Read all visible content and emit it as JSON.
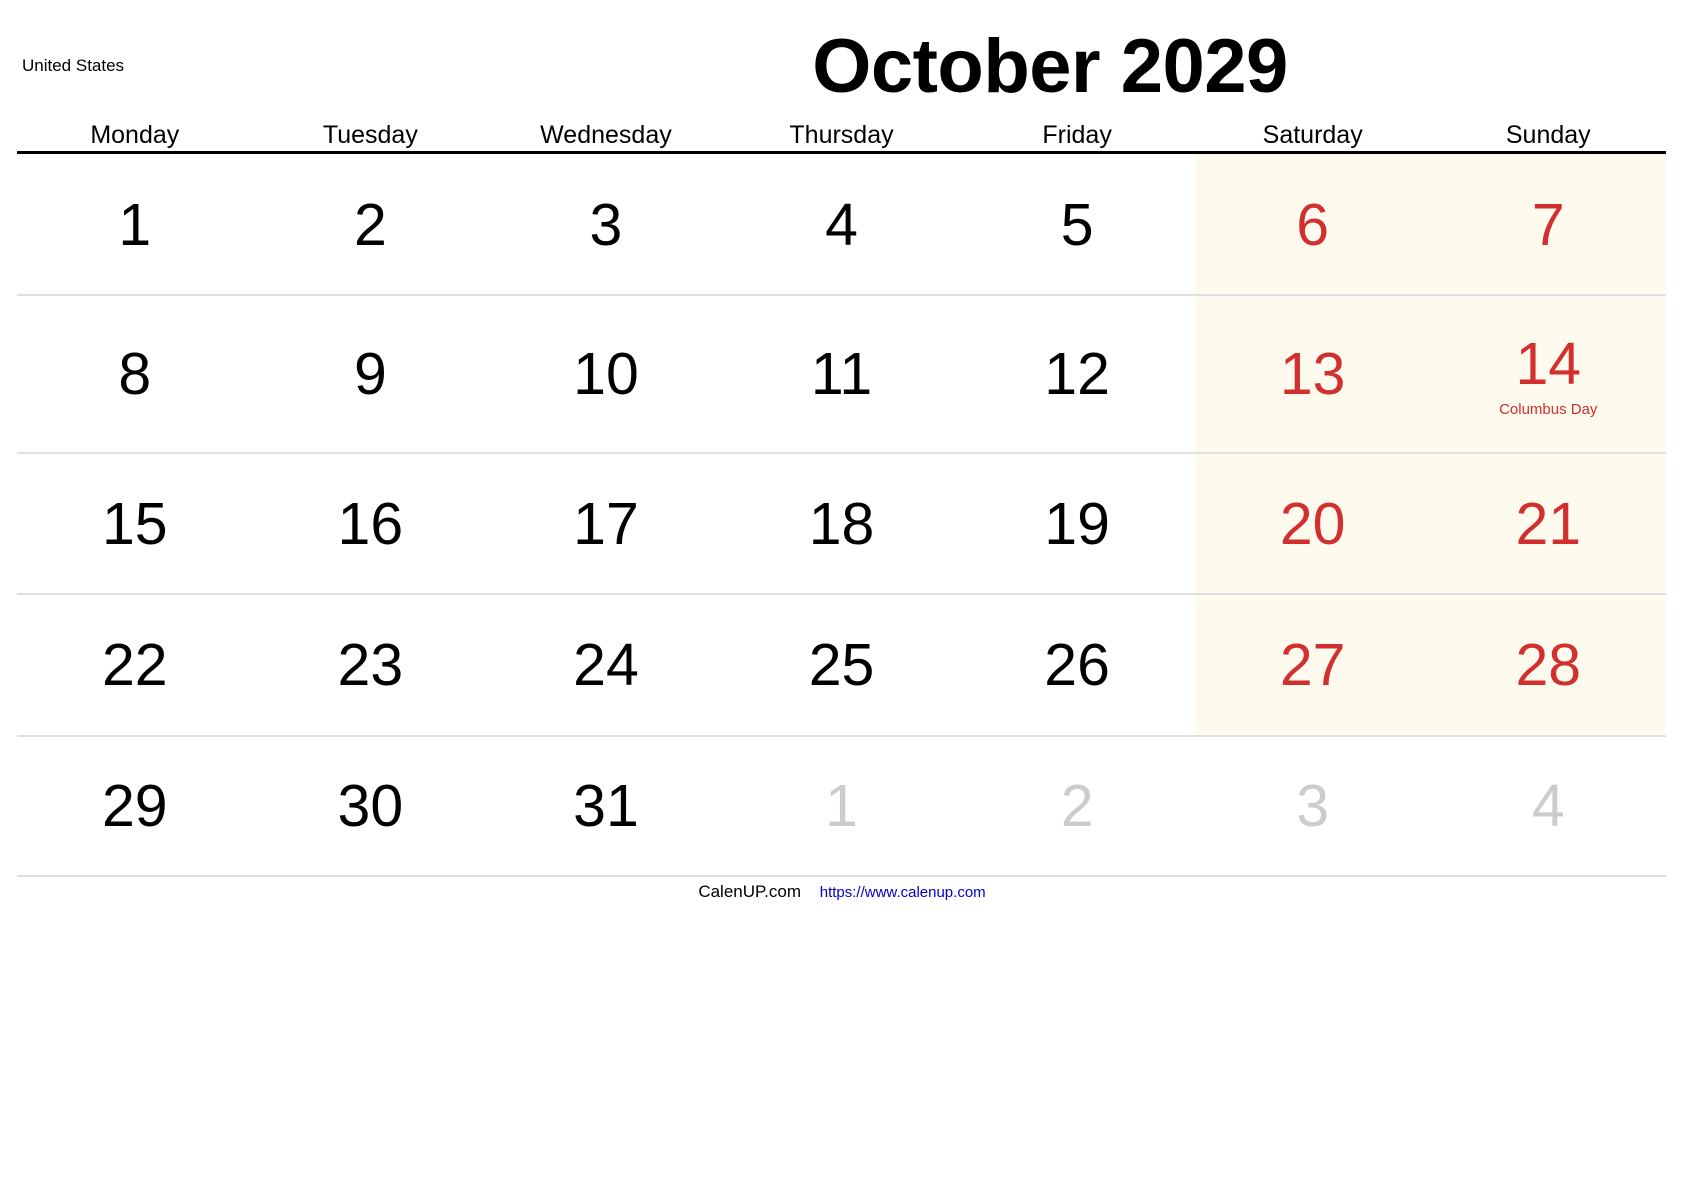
{
  "country": "United States",
  "title": "October 2029",
  "weekdays": [
    "Monday",
    "Tuesday",
    "Wednesday",
    "Thursday",
    "Friday",
    "Saturday",
    "Sunday"
  ],
  "colors": {
    "weekend_text": "#d22f2f",
    "weekend_background": "#fffaee",
    "other_month_text": "#cccccc",
    "link": "#0000cc"
  },
  "weeks": [
    [
      {
        "day": "1",
        "type": "weekday"
      },
      {
        "day": "2",
        "type": "weekday"
      },
      {
        "day": "3",
        "type": "weekday"
      },
      {
        "day": "4",
        "type": "weekday"
      },
      {
        "day": "5",
        "type": "weekday"
      },
      {
        "day": "6",
        "type": "weekend"
      },
      {
        "day": "7",
        "type": "weekend"
      }
    ],
    [
      {
        "day": "8",
        "type": "weekday"
      },
      {
        "day": "9",
        "type": "weekday"
      },
      {
        "day": "10",
        "type": "weekday"
      },
      {
        "day": "11",
        "type": "weekday"
      },
      {
        "day": "12",
        "type": "weekday"
      },
      {
        "day": "13",
        "type": "weekend"
      },
      {
        "day": "14",
        "type": "weekend",
        "holiday": "Columbus Day"
      }
    ],
    [
      {
        "day": "15",
        "type": "weekday"
      },
      {
        "day": "16",
        "type": "weekday"
      },
      {
        "day": "17",
        "type": "weekday"
      },
      {
        "day": "18",
        "type": "weekday"
      },
      {
        "day": "19",
        "type": "weekday"
      },
      {
        "day": "20",
        "type": "weekend"
      },
      {
        "day": "21",
        "type": "weekend"
      }
    ],
    [
      {
        "day": "22",
        "type": "weekday"
      },
      {
        "day": "23",
        "type": "weekday"
      },
      {
        "day": "24",
        "type": "weekday"
      },
      {
        "day": "25",
        "type": "weekday"
      },
      {
        "day": "26",
        "type": "weekday"
      },
      {
        "day": "27",
        "type": "weekend"
      },
      {
        "day": "28",
        "type": "weekend"
      }
    ],
    [
      {
        "day": "29",
        "type": "weekday"
      },
      {
        "day": "30",
        "type": "weekday"
      },
      {
        "day": "31",
        "type": "weekday"
      },
      {
        "day": "1",
        "type": "other"
      },
      {
        "day": "2",
        "type": "other"
      },
      {
        "day": "3",
        "type": "other"
      },
      {
        "day": "4",
        "type": "other"
      }
    ]
  ],
  "footer": {
    "brand": "CalenUP.com",
    "link": "https://www.calenup.com"
  }
}
